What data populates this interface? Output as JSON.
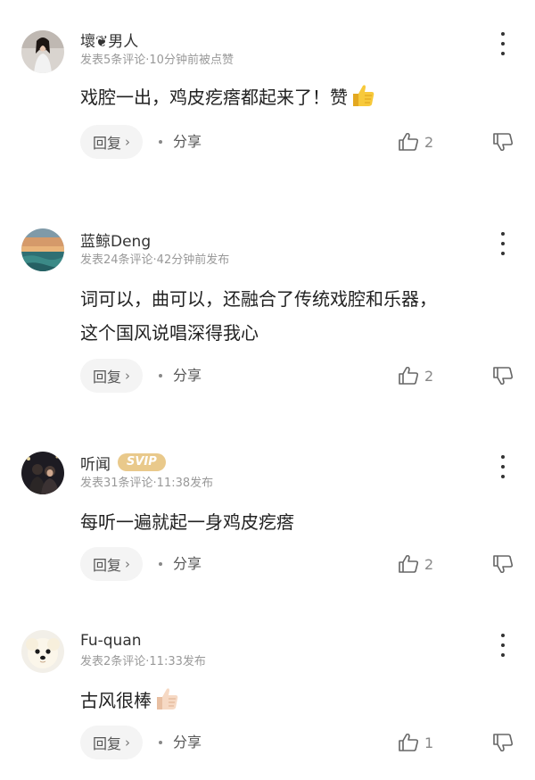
{
  "comments": [
    {
      "username": "壞❦男人",
      "badge": "",
      "meta": "发表5条评论·10分钟前被点赞",
      "lines": [
        "戏腔一出，鸡皮疙瘩都起来了！赞"
      ],
      "emoji": "thumbs-up-yellow",
      "reply_label": "回复",
      "share_label": "分享",
      "likes": "2",
      "avatar": "woman-photo-avatar"
    },
    {
      "username": "蓝鲸Deng",
      "badge": "",
      "meta": "发表24条评论·42分钟前发布",
      "lines": [
        "词可以，曲可以，还融合了传统戏腔和乐器，",
        "这个国风说唱深得我心"
      ],
      "emoji": "",
      "reply_label": "回复",
      "share_label": "分享",
      "likes": "2",
      "avatar": "ocean-sunset-avatar"
    },
    {
      "username": "听闻",
      "badge": "SVIP",
      "meta": "发表31条评论·11:38发布",
      "lines": [
        "每听一遍就起一身鸡皮疙瘩"
      ],
      "emoji": "",
      "reply_label": "回复",
      "share_label": "分享",
      "likes": "2",
      "avatar": "couple-night-avatar"
    },
    {
      "username": "Fu-quan",
      "badge": "",
      "meta": "发表2条评论·11:33发布",
      "lines": [
        "古风很棒"
      ],
      "emoji": "thumbs-up-light",
      "reply_label": "回复",
      "share_label": "分享",
      "likes": "1",
      "avatar": "pomeranian-dog-avatar"
    }
  ],
  "colors": {
    "svip_badge": "#e9c98b",
    "meta_text": "#999999",
    "reply_bg": "#f4f4f4",
    "emoji_yellow": "#f7c93b",
    "emoji_light": "#f6d9c4"
  }
}
